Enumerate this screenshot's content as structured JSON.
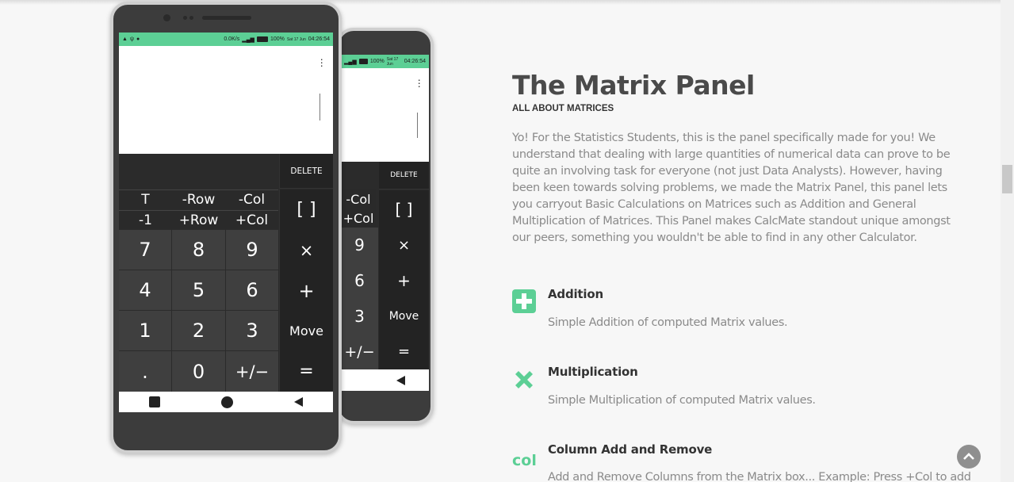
{
  "section": {
    "title": "The Matrix Panel",
    "subtitle": "ALL ABOUT MATRICES",
    "description": "Yo! For the Statistics Students, this is the panel specifically made for you! We understand that dealing with large quantities of numerical data can prove to be quite an involving task for everyone (not just Data Analysts). However, having been keen towards solving problems, we made the Matrix Panel, this panel lets you carryout Basic Calculations on Matrices such as Addition and General Multiplication of Matrices. This Panel makes CalcMate standout unique amongst our peers, something you wouldn't be able to find in any other Calculator."
  },
  "features": [
    {
      "icon": "plus-square-icon",
      "title": "Addition",
      "desc": "Simple Addition of computed Matrix values."
    },
    {
      "icon": "cross-icon",
      "title": "Multiplication",
      "desc": "Simple Multiplication of computed Matrix values."
    },
    {
      "icon": "col-text-icon",
      "icon_text": "col",
      "title": "Column Add and Remove",
      "desc": "Add and Remove Columns from the Matrix box... Example: Press +Col to add"
    }
  ],
  "phone_front": {
    "status_speed": "0.0K/s",
    "status_battery": "100%",
    "status_date": "Sat 17 Jun",
    "status_time": "04:26:54",
    "delete_label": "DELETE",
    "matrix_keys": [
      "T",
      "-Row",
      "-Col",
      "-1",
      "+Row",
      "+Col"
    ],
    "bracket_label": "[ ]",
    "digits": [
      "7",
      "8",
      "9",
      "4",
      "5",
      "6",
      "1",
      "2",
      "3",
      ".",
      "0",
      "+/−"
    ],
    "ops": [
      "×",
      "+",
      "Move",
      "="
    ]
  },
  "phone_back": {
    "status_battery": "100%",
    "status_date": "Sat 17 Jun",
    "status_time": "04:26:54",
    "delete_label": "DELETE",
    "matrix_keys": [
      "-Col",
      "+Col"
    ],
    "bracket_label": "[ ]",
    "digits": [
      "9",
      "6",
      "3",
      "+/−"
    ],
    "ops": [
      "×",
      "+",
      "Move",
      "="
    ]
  },
  "colors": {
    "accent": "#5ccf95",
    "title": "#4a4a4a",
    "body_text": "#8a8a8a"
  }
}
